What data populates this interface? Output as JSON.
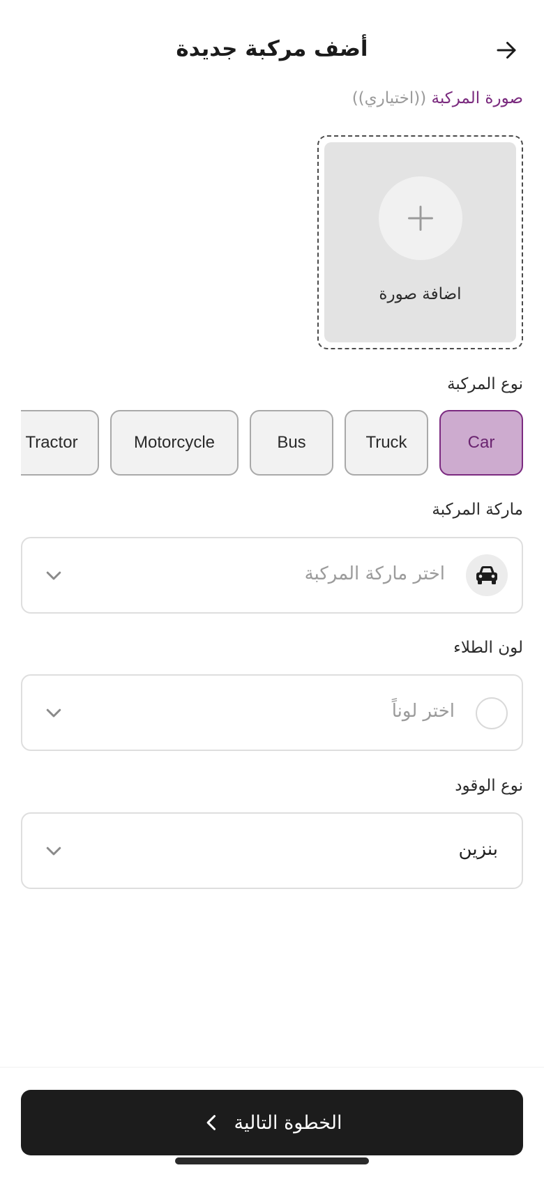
{
  "header": {
    "title": "أضف مركبة جديدة",
    "back_icon": "arrow-right-icon"
  },
  "photo": {
    "label": "صورة المركبة",
    "optional": "((اختياري))",
    "add_text": "اضافة صورة",
    "icon": "plus-icon"
  },
  "vehicle_type": {
    "label": "نوع المركبة",
    "options": [
      "Car",
      "Truck",
      "Bus",
      "Motorcycle",
      "Tractor"
    ],
    "selected": "Car"
  },
  "brand": {
    "label": "ماركة المركبة",
    "placeholder": "اختر ماركة المركبة",
    "icon": "car-icon"
  },
  "paint_color": {
    "label": "لون الطلاء",
    "placeholder": "اختر لوناً"
  },
  "fuel_type": {
    "label": "نوع الوقود",
    "value": "بنزين"
  },
  "footer": {
    "next_label": "الخطوة التالية",
    "next_icon": "chevron-left-icon"
  },
  "colors": {
    "accent": "#7b2a80",
    "accent_light": "#cdabcf",
    "button_dark": "#1c1c1c",
    "chip_bg": "#f2f2f2"
  }
}
